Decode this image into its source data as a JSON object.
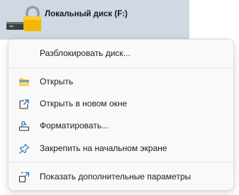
{
  "drive": {
    "label": "Локальный диск (F:)",
    "icon": "locked-drive-icon",
    "state": "selected"
  },
  "context_menu": {
    "items": [
      {
        "label": "Разблокировать диск...",
        "icon": ""
      },
      {
        "label": "Открыть",
        "icon": "folder-icon"
      },
      {
        "label": "Открыть в новом окне",
        "icon": "open-new-window-icon"
      },
      {
        "label": "Форматировать...",
        "icon": "format-icon"
      },
      {
        "label": "Закрепить на начальном экране",
        "icon": "pin-icon"
      },
      {
        "label": "Показать дополнительные параметры",
        "icon": "show-more-options-icon"
      }
    ]
  },
  "colors": {
    "selection": "#cfd8e3",
    "menu_background": "#f9f9f9",
    "accent_blue": "#1a6fc4",
    "lock_gold": "#f2b705",
    "folder_yellow": "#f6c244"
  }
}
